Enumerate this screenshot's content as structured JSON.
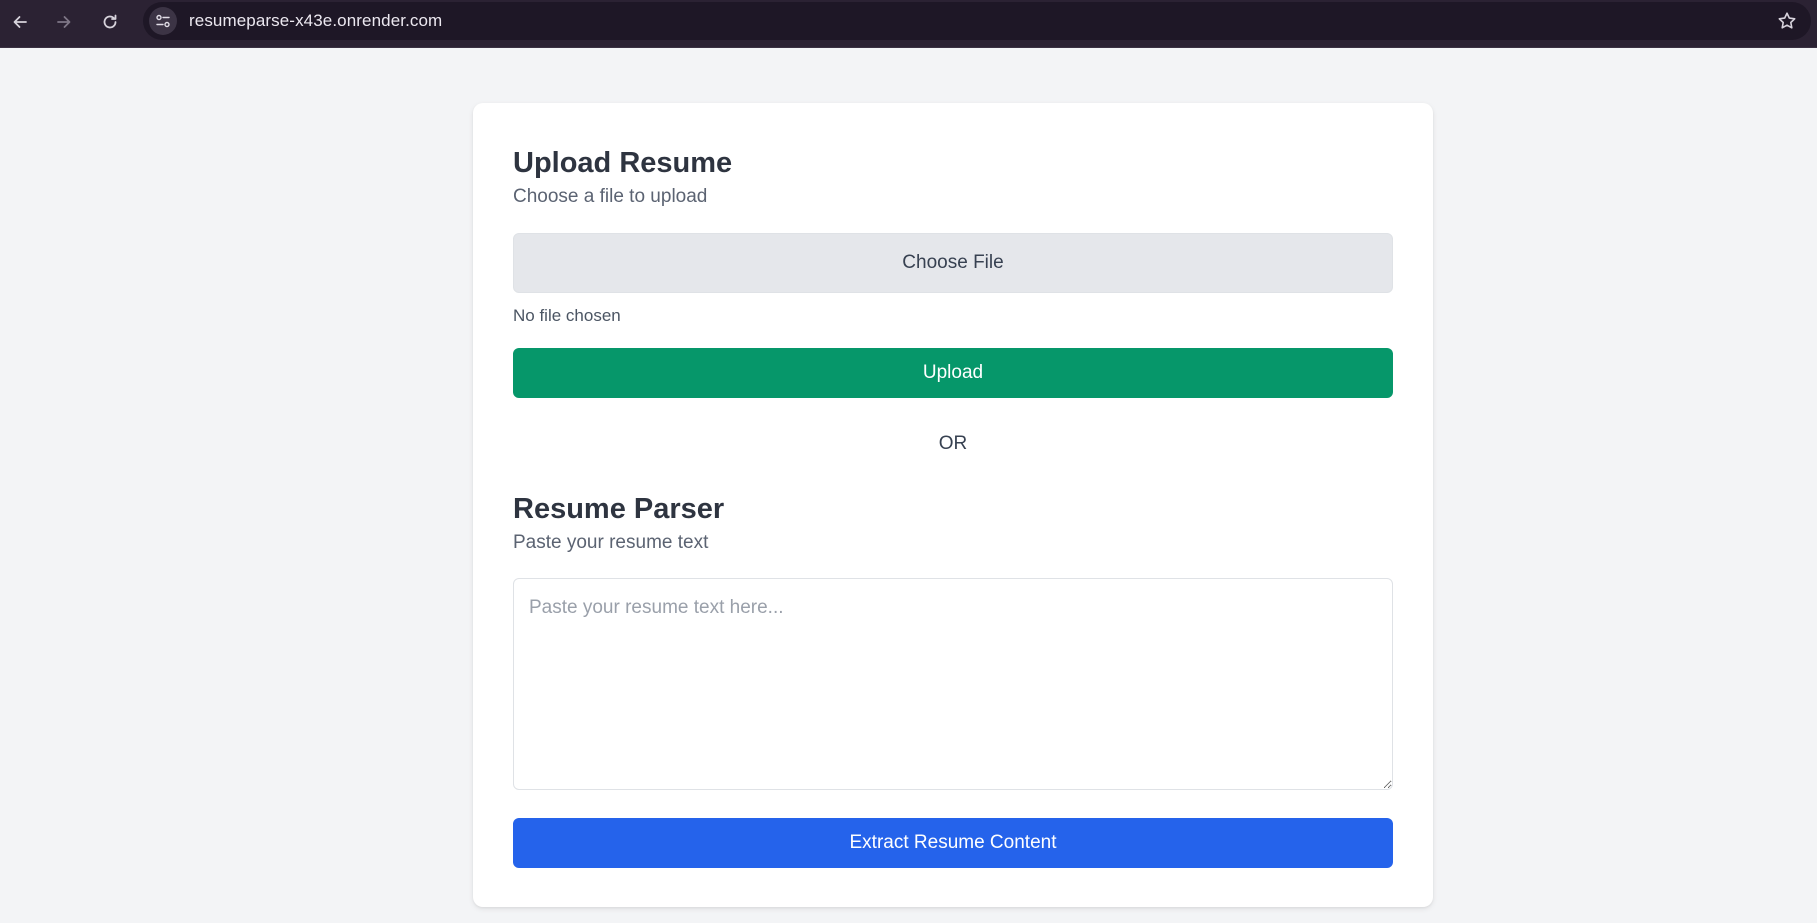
{
  "browser": {
    "url": "resumeparse-x43e.onrender.com",
    "icons": {
      "back": "back-arrow-icon",
      "forward": "forward-arrow-icon",
      "reload": "reload-icon",
      "site_info": "site-info-icon",
      "bookmark": "star-icon"
    }
  },
  "upload": {
    "title": "Upload Resume",
    "subtitle": "Choose a file to upload",
    "choose_file_label": "Choose File",
    "file_status": "No file chosen",
    "upload_label": "Upload"
  },
  "divider": {
    "label": "OR"
  },
  "parser": {
    "title": "Resume Parser",
    "subtitle": "Paste your resume text",
    "textarea_value": "",
    "textarea_placeholder": "Paste your resume text here...",
    "extract_label": "Extract Resume Content"
  },
  "colors": {
    "page_background": "#f3f4f6",
    "upload_button": "#06976a",
    "extract_button": "#2563eb",
    "choose_file_button": "#e5e7eb",
    "browser_chrome": "#2b2233"
  }
}
